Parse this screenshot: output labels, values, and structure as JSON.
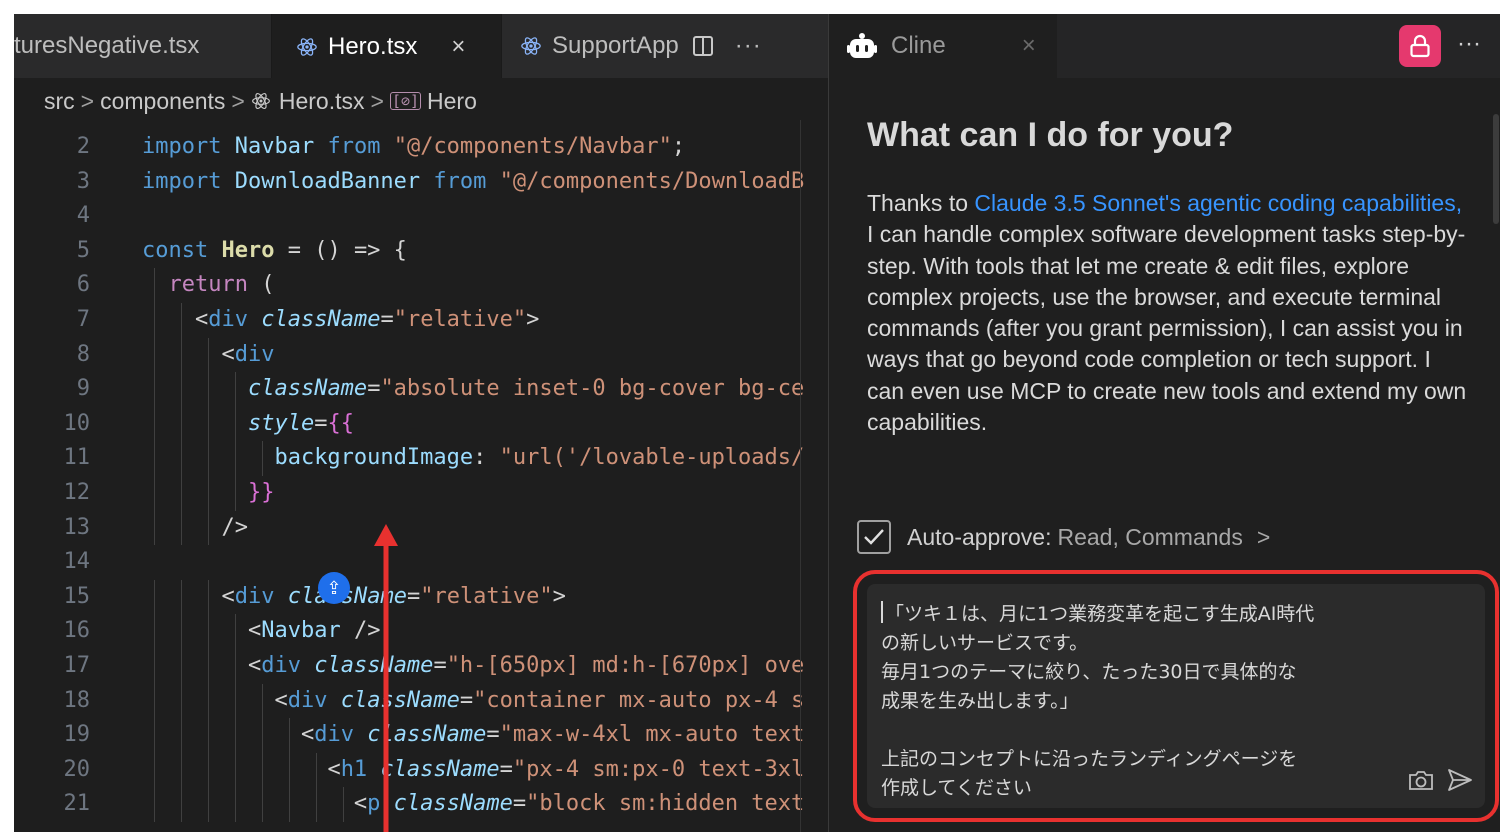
{
  "editor": {
    "tabs": [
      {
        "label": "turesNegative.tsx"
      },
      {
        "label": "Hero.tsx",
        "close": "×"
      },
      {
        "label": "SupportApp",
        "more": "···"
      }
    ],
    "breadcrumb": [
      "src",
      "components",
      "Hero.tsx",
      "Hero"
    ],
    "breadcrumb_sep": ">",
    "line_numbers": [
      "2",
      "3",
      "4",
      "5",
      "6",
      "7",
      "8",
      "9",
      "10",
      "11",
      "12",
      "13",
      "14",
      "15",
      "16",
      "17",
      "18",
      "19",
      "20",
      "21"
    ],
    "code_lines": [
      "import Navbar from \"@/components/Navbar\";",
      "import DownloadBanner from \"@/components/DownloadB",
      "",
      "const Hero = () => {",
      "  return (",
      "    <div className=\"relative\">",
      "      <div",
      "        className=\"absolute inset-0 bg-cover bg-ce",
      "        style={{",
      "          backgroundImage: \"url('/lovable-uploads/",
      "        }}",
      "      />",
      "",
      "      <div className=\"relative\">",
      "        <Navbar />",
      "        <div className=\"h-[650px] md:h-[670px] ove",
      "          <div className=\"container mx-auto px-4 s",
      "            <div className=\"max-w-4xl mx-auto text",
      "              <h1 className=\"px-4 sm:px-0 text-3xl",
      "                <p className=\"block sm:hidden text"
    ]
  },
  "cline": {
    "tab_label": "Cline",
    "tab_close": "×",
    "more": "···",
    "heading": "What can I do for you?",
    "intro_prefix": "Thanks to ",
    "intro_link": "Claude 3.5 Sonnet's agentic coding capabilities,",
    "intro_rest": " I can handle complex software development tasks step-by-step. With tools that let me create & edit files, explore complex projects, use the browser, and execute terminal commands (after you grant permission), I can assist you in ways that go beyond code completion or tech support. I can even use MCP to create new tools and extend my own capabilities.",
    "auto_approve_label": "Auto-approve:",
    "auto_approve_value": "Read, Commands",
    "auto_approve_chevron": ">",
    "input_text": "「ツキ１は、月に1つ業務変革を起こす生成AI時代\nの新しいサービスです。\n毎月1つのテーマに絞り、たった30日で具体的な\n成果を生み出します。」\n\n上記のコンセプトに沿ったランディングページを\n作成してください"
  },
  "colors": {
    "accent_link": "#3794ff",
    "highlight_border": "#e8312f",
    "annotation_arrow": "#e8312f",
    "lock_button": "#e5396e"
  }
}
